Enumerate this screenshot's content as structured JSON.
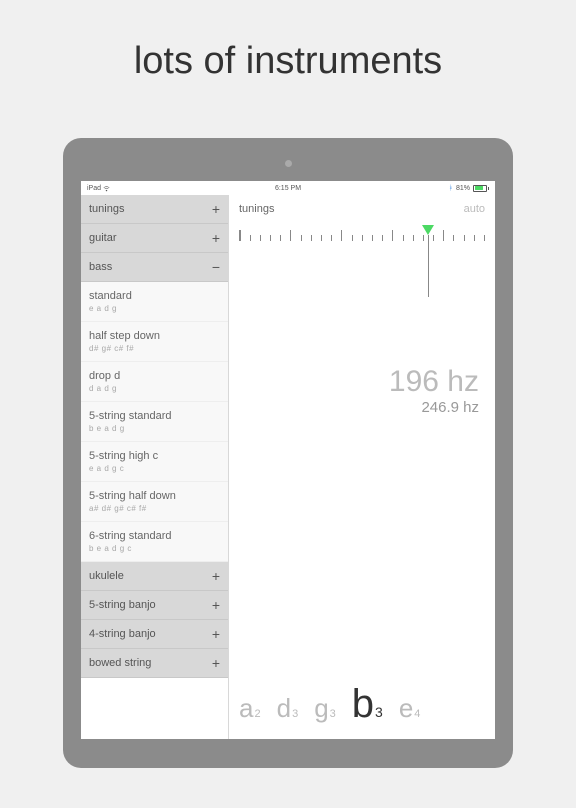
{
  "headline": "lots of instruments",
  "status": {
    "device": "iPad",
    "time": "6:15 PM",
    "battery_pct": "81%"
  },
  "sidebar": {
    "top_categories": [
      {
        "label": "tunings",
        "icon": "+"
      },
      {
        "label": "guitar",
        "icon": "+"
      },
      {
        "label": "bass",
        "icon": "−"
      }
    ],
    "tunings": [
      {
        "title": "standard",
        "notes": "e a d g"
      },
      {
        "title": "half step down",
        "notes": "d# g# c# f#"
      },
      {
        "title": "drop d",
        "notes": "d a d g"
      },
      {
        "title": "5-string standard",
        "notes": "b e a d g"
      },
      {
        "title": "5-string high c",
        "notes": "e a d g c"
      },
      {
        "title": "5-string half down",
        "notes": "a# d# g# c# f#"
      },
      {
        "title": "6-string standard",
        "notes": "b e a d g c"
      }
    ],
    "bottom_categories": [
      {
        "label": "ukulele",
        "icon": "+"
      },
      {
        "label": "5-string banjo",
        "icon": "+"
      },
      {
        "label": "4-string banjo",
        "icon": "+"
      },
      {
        "label": "bowed string",
        "icon": "+"
      }
    ]
  },
  "main": {
    "title": "tunings",
    "auto": "auto",
    "hz_big": "196 hz",
    "hz_small": "246.9 hz",
    "notes": [
      {
        "letter": "a",
        "oct": "2"
      },
      {
        "letter": "d",
        "oct": "3"
      },
      {
        "letter": "g",
        "oct": "3"
      },
      {
        "letter": "b",
        "oct": "3",
        "current": true
      },
      {
        "letter": "e",
        "oct": "4"
      }
    ]
  }
}
